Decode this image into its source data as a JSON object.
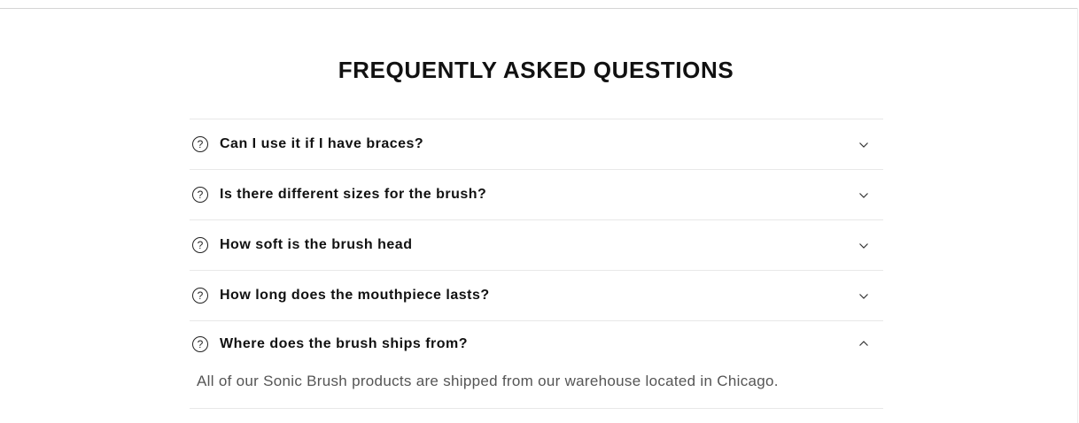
{
  "faq": {
    "title": "FREQUENTLY ASKED QUESTIONS",
    "items": [
      {
        "question": "Can I use it if I have braces?",
        "expanded": false,
        "icon": "question-circle-icon"
      },
      {
        "question": "Is there different sizes for the brush?",
        "expanded": false,
        "icon": "question-circle-icon"
      },
      {
        "question": "How soft is the brush head",
        "expanded": false,
        "icon": "question-circle-icon"
      },
      {
        "question": "How long does the mouthpiece lasts?",
        "expanded": false,
        "icon": "question-circle-icon"
      },
      {
        "question": "Where does the brush ships from?",
        "expanded": true,
        "icon": "question-circle-icon",
        "answer": "All of our Sonic Brush products are shipped from our warehouse located in Chicago."
      }
    ]
  },
  "icons": {
    "question_glyph": "?",
    "collapsed_chevron": "chevron-down-icon",
    "expanded_chevron": "chevron-up-icon"
  },
  "colors": {
    "heading": "#111111",
    "answer_text": "#555555",
    "divider": "#e8e8e8"
  }
}
